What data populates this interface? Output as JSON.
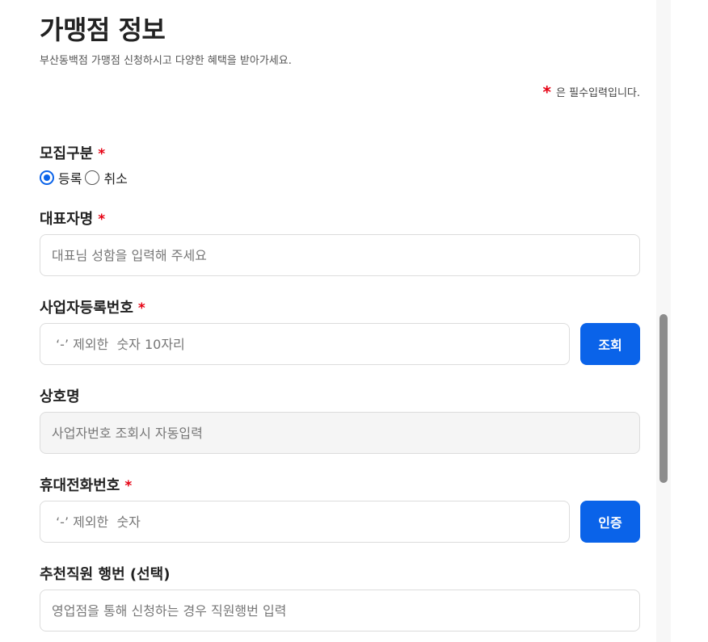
{
  "header": {
    "title": "가맹점 정보",
    "subtitle": "부산동백점 가맹점 신청하시고 다양한 혜택을 받아가세요.",
    "required_star": "*",
    "required_note": "은 필수입력입니다."
  },
  "form": {
    "recruit_type": {
      "label": "모집구분",
      "required": "*",
      "options": [
        {
          "label": "등록",
          "checked": true
        },
        {
          "label": "취소",
          "checked": false
        }
      ]
    },
    "representative": {
      "label": "대표자명",
      "required": "*",
      "placeholder": "대표님 성함을 입력해 주세요",
      "value": ""
    },
    "business_number": {
      "label": "사업자등록번호",
      "required": "*",
      "placeholder": " ‘-’ 제외한  숫자 10자리",
      "value": "",
      "button_label": "조회"
    },
    "company_name": {
      "label": "상호명",
      "placeholder": "사업자번호 조회시 자동입력",
      "value": ""
    },
    "mobile": {
      "label": "휴대전화번호",
      "required": "*",
      "placeholder": " ‘-’ 제외한  숫자",
      "value": "",
      "button_label": "인증"
    },
    "referrer": {
      "label": "추천직원 행번 (선택)",
      "placeholder": "영업점을 통해 신청하는 경우 직원행번 입력",
      "value": ""
    }
  },
  "colors": {
    "accent": "#0a63e9",
    "required": "#e60012",
    "readonly_bg": "#f5f5f5"
  }
}
